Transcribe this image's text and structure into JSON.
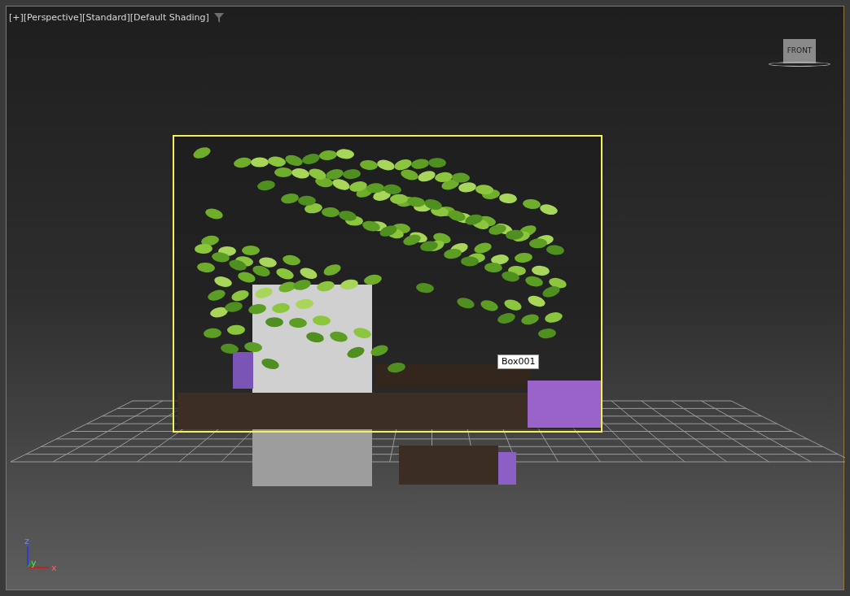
{
  "viewport": {
    "labels": [
      "[+]",
      "[Perspective]",
      "[Standard]",
      "[Default Shading]"
    ],
    "viewcube": {
      "face": "FRONT"
    },
    "tooltip": "Box001",
    "axis": {
      "z": "z",
      "y": "y",
      "x": "x"
    }
  }
}
